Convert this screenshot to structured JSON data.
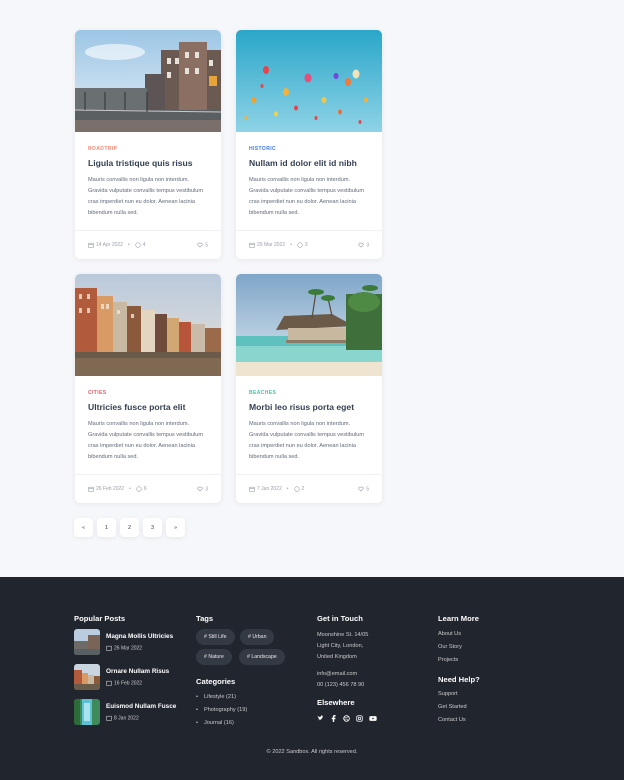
{
  "cards": [
    {
      "category": "Roadtrip",
      "category_color": "#f78b77",
      "title": "Ligula tristique quis risus",
      "excerpt": "Mauris convallis non ligula non interdum. Gravida vulputate convallis tempus vestibulum cras imperdiet nun eu dolor. Aenean lacinia bibendum nulla sed.",
      "date": "14 Apr 2022",
      "comments": "4",
      "likes": "5",
      "image": "city-street-canal"
    },
    {
      "category": "Historic",
      "category_color": "#3f78e0",
      "title": "Nullam id dolor elit id nibh",
      "excerpt": "Mauris convallis non ligula non interdum. Gravida vulputate convallis tempus vestibulum cras imperdiet nun eu dolor. Aenean lacinia bibendum nulla sed.",
      "date": "29 Mar 2022",
      "comments": "3",
      "likes": "3",
      "image": "hot-air-balloons"
    },
    {
      "category": "Cities",
      "category_color": "#e2626b",
      "title": "Ultricies fusce porta elit",
      "excerpt": "Mauris convallis non ligula non interdum. Gravida vulputate convallis tempus vestibulum cras imperdiet nun eu dolor. Aenean lacinia bibendum nulla sed.",
      "date": "26 Feb 2022",
      "comments": "6",
      "likes": "3",
      "image": "canal-houses"
    },
    {
      "category": "Beaches",
      "category_color": "#45c4a0",
      "title": "Morbi leo risus porta eget",
      "excerpt": "Mauris convallis non ligula non interdum. Gravida vulputate convallis tempus vestibulum cras imperdiet nun eu dolor. Aenean lacinia bibendum nulla sed.",
      "date": "7 Jan 2022",
      "comments": "2",
      "likes": "5",
      "image": "beach-bungalow"
    }
  ],
  "pagination": {
    "prev": "«",
    "pages": [
      "1",
      "2",
      "3"
    ],
    "next": "»"
  },
  "footer": {
    "popular_title": "Popular Posts",
    "popular": [
      {
        "title": "Magna Mollis Ultricies",
        "date": "26 Mar 2022"
      },
      {
        "title": "Ornare Nullam Risus",
        "date": "16 Feb 2022"
      },
      {
        "title": "Euismod Nullam Fusce",
        "date": "8 Jan 2022"
      }
    ],
    "tags_title": "Tags",
    "tags": [
      "# Still Life",
      "# Urban",
      "# Nature",
      "# Landscape"
    ],
    "categories_title": "Categories",
    "categories": [
      "Lifestyle (21)",
      "Photography (19)",
      "Journal (16)"
    ],
    "touch_title": "Get in Touch",
    "address": [
      "Moonshine St. 14/05",
      "Light City, London,",
      "United Kingdom"
    ],
    "email": "info@email.com",
    "phone": "00 (123) 456 78 90",
    "elsewhere_title": "Elsewhere",
    "social_icons": [
      "twitter-icon",
      "facebook-icon",
      "dribbble-icon",
      "instagram-icon",
      "youtube-icon"
    ],
    "learn_title": "Learn More",
    "learn_links": [
      "About Us",
      "Our Story",
      "Projects"
    ],
    "help_title": "Need Help?",
    "help_links": [
      "Support",
      "Get Started",
      "Contact Us"
    ],
    "copyright": "© 2022 Sandbox. All rights reserved."
  }
}
